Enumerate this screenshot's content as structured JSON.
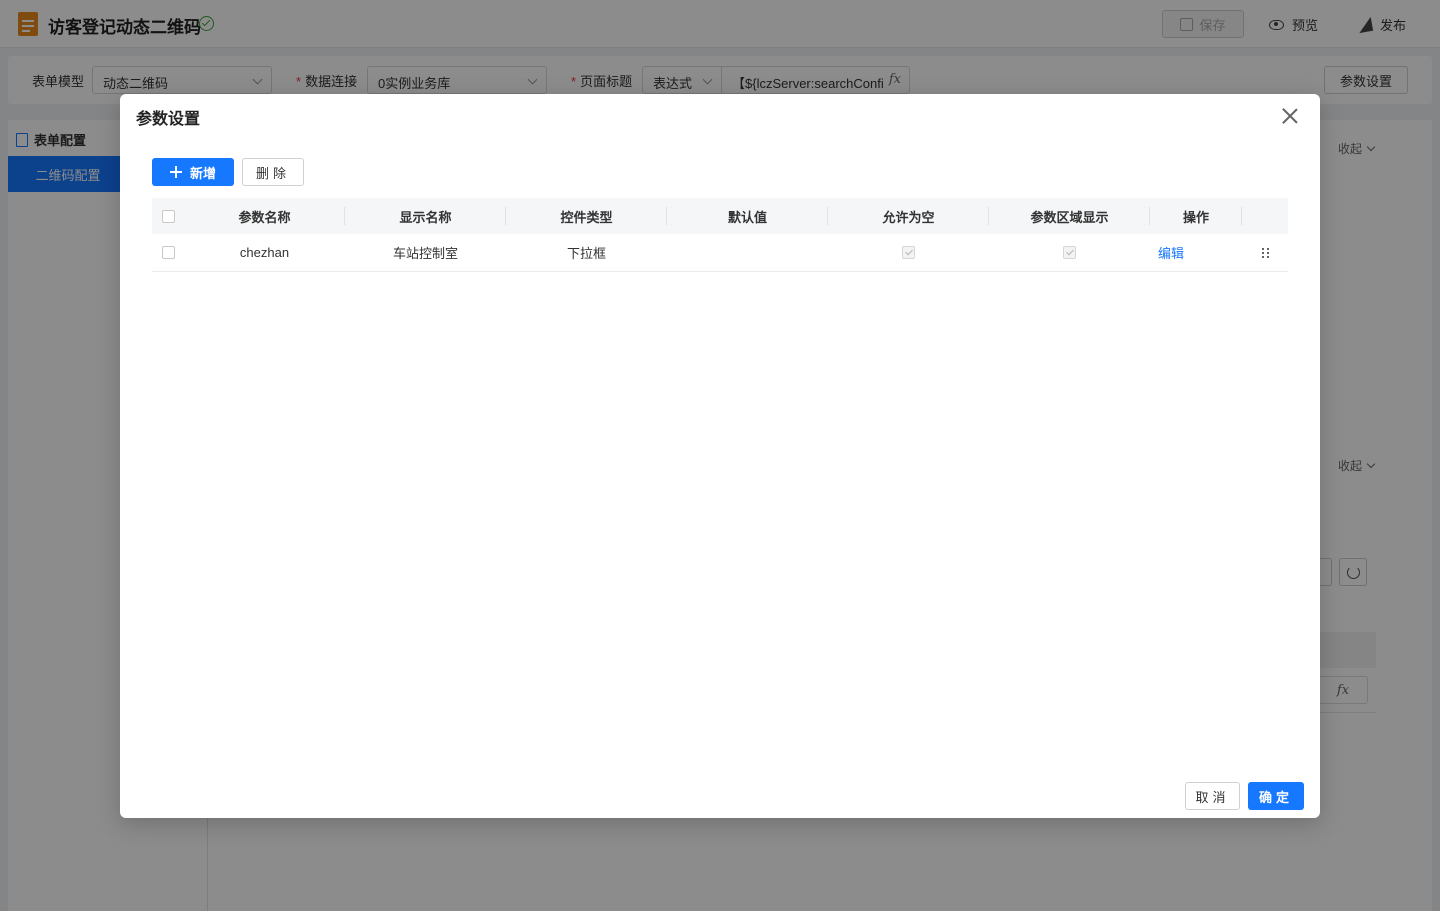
{
  "app": {
    "title": "访客登记动态二维码",
    "save_label": "保存",
    "preview_label": "预览",
    "publish_label": "发布"
  },
  "config": {
    "form_model_label": "表单模型",
    "form_model_value": "动态二维码",
    "data_conn_label": "数据连接",
    "data_conn_value": "0实例业务库",
    "page_title_label": "页面标题",
    "page_title_mode": "表达式",
    "page_title_expr": "【${lczServer:searchConfi",
    "param_settings_label": "参数设置",
    "fx_label": "fx"
  },
  "sidebar": {
    "header": "表单配置",
    "items": [
      {
        "label": "二维码配置"
      }
    ]
  },
  "main": {
    "collapse_label": "收起"
  },
  "modal": {
    "title": "参数设置",
    "add_label": "新增",
    "delete_label": "删除",
    "cancel_label": "取消",
    "ok_label": "确定",
    "columns": [
      "参数名称",
      "显示名称",
      "控件类型",
      "默认值",
      "允许为空",
      "参数区域显示",
      "操作"
    ],
    "rows": [
      {
        "param_name": "chezhan",
        "display_name": "车站控制室",
        "control_type": "下拉框",
        "default_value": "",
        "allow_empty": true,
        "show_in_area": true,
        "action": "编辑"
      }
    ]
  },
  "colors": {
    "primary": "#1677ff",
    "success": "#3aa53a",
    "required": "#e34",
    "accent_orange": "#e8891a"
  }
}
